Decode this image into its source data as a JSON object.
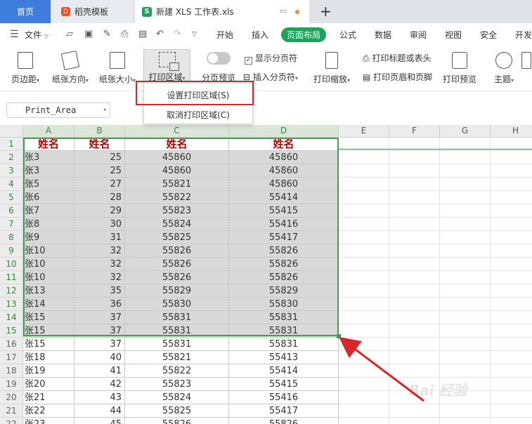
{
  "tabs": {
    "home": "首页",
    "template": "稻壳模板",
    "file": "新建 XLS 工作表.xls"
  },
  "menu": {
    "file_label": "文件",
    "items": [
      "开始",
      "插入",
      "页面布局",
      "公式",
      "数据",
      "审阅",
      "视图",
      "安全",
      "开发"
    ],
    "active": "页面布局"
  },
  "ribbon": {
    "margins": "页边距",
    "orientation": "纸张方向",
    "paper_size": "纸张大小",
    "print_area": "打印区域",
    "page_break_preview": "分页预览",
    "show_page_breaks": "显示分页符",
    "insert_page_break": "插入分页符",
    "print_scale": "打印缩放",
    "print_titles": "打印标题或表头",
    "header_footer": "打印页眉和页脚",
    "print_preview": "打印预览",
    "theme": "主题"
  },
  "dropdown": {
    "set_print_area": "设置打印区域(S)",
    "clear_print_area": "取消打印区域(C)"
  },
  "namebox": {
    "value": "Print_Area"
  },
  "columns": [
    "A",
    "B",
    "C",
    "D",
    "E",
    "F",
    "G",
    "H"
  ],
  "rows": [
    [
      "姓名",
      "姓名",
      "姓名",
      "姓名"
    ],
    [
      "张3",
      "25",
      "45860",
      "45860"
    ],
    [
      "张3",
      "25",
      "45860",
      "45860"
    ],
    [
      "张5",
      "27",
      "55821",
      "45860"
    ],
    [
      "张6",
      "28",
      "55822",
      "55414"
    ],
    [
      "张7",
      "29",
      "55823",
      "55415"
    ],
    [
      "张8",
      "30",
      "55824",
      "55416"
    ],
    [
      "张9",
      "31",
      "55825",
      "55417"
    ],
    [
      "张10",
      "32",
      "55826",
      "55826"
    ],
    [
      "张10",
      "32",
      "55826",
      "55826"
    ],
    [
      "张10",
      "32",
      "55826",
      "55826"
    ],
    [
      "张13",
      "35",
      "55829",
      "55829"
    ],
    [
      "张14",
      "36",
      "55830",
      "55830"
    ],
    [
      "张15",
      "37",
      "55831",
      "55831"
    ],
    [
      "张15",
      "37",
      "55831",
      "55831"
    ],
    [
      "张15",
      "37",
      "55831",
      "55831"
    ],
    [
      "张18",
      "40",
      "55821",
      "55413"
    ],
    [
      "张19",
      "41",
      "55822",
      "55414"
    ],
    [
      "张20",
      "42",
      "55823",
      "55415"
    ],
    [
      "张21",
      "43",
      "55824",
      "55416"
    ],
    [
      "张22",
      "44",
      "55825",
      "55417"
    ],
    [
      "张23",
      "45",
      "55826",
      "55826"
    ]
  ],
  "selected_rows": 15,
  "accent": "#18a659",
  "highlight_color": "#d8262a",
  "icons": [
    "menu-icon",
    "folder-icon",
    "save-icon",
    "print-icon",
    "undo-icon",
    "redo-icon"
  ],
  "watermark": "Bai 经验"
}
